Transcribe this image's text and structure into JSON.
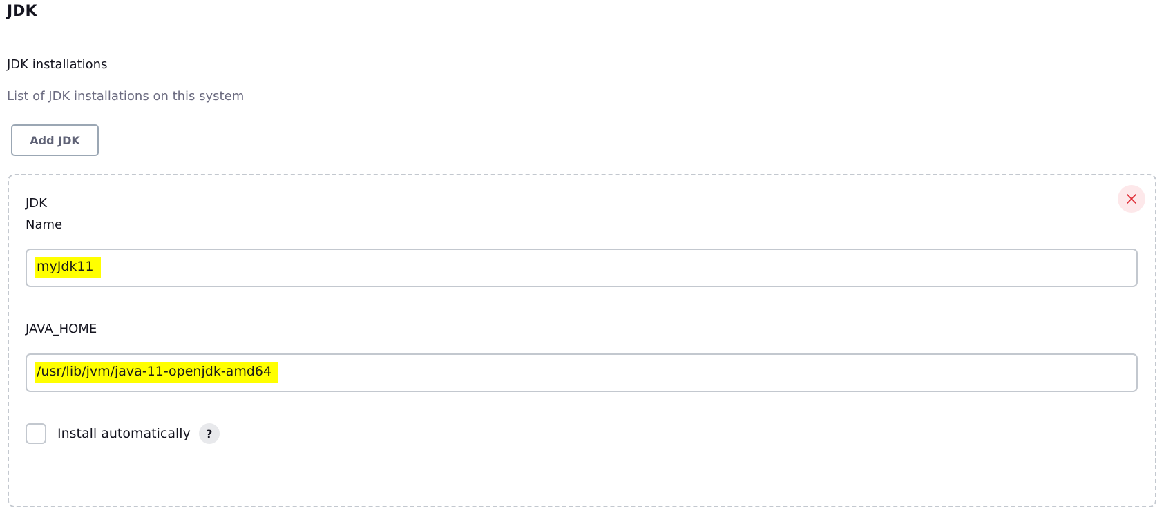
{
  "section": {
    "title": "JDK"
  },
  "installations": {
    "label": "JDK installations",
    "description": "List of JDK installations on this system",
    "add_button_label": "Add JDK"
  },
  "jdk_entry": {
    "heading": "JDK",
    "name_label": "Name",
    "name_value": "myJdk11",
    "java_home_label": "JAVA_HOME",
    "java_home_value": "/usr/lib/jvm/java-11-openjdk-amd64",
    "install_automatically_label": "Install automatically",
    "install_automatically_checked": false,
    "help_icon": "?",
    "close_icon": "close-icon"
  },
  "colors": {
    "highlight": "#ffff00",
    "close_button_bg": "#fde8ea",
    "close_icon": "#e0313a",
    "border": "#c3c8cf"
  }
}
